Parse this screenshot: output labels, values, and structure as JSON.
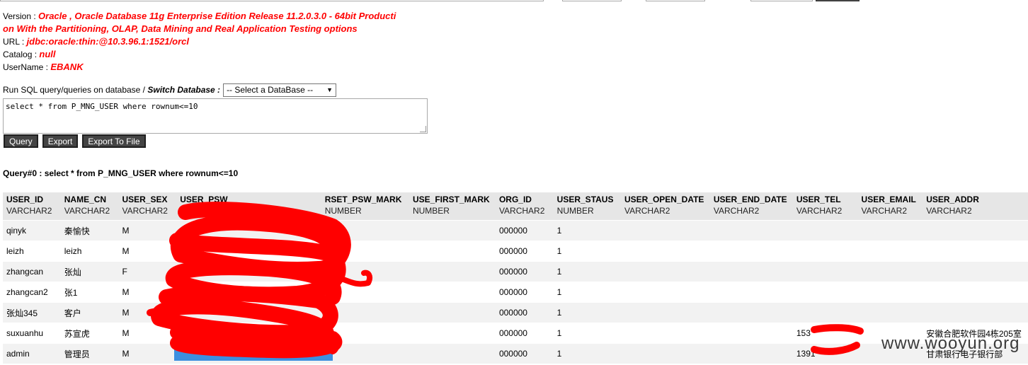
{
  "info": {
    "version_label": "Version : ",
    "version_value_1": "Oracle , Oracle Database 11g Enterprise Edition Release 11.2.0.3.0 - 64bit Producti",
    "version_value_2": "on With the Partitioning, OLAP, Data Mining and Real Application Testing options",
    "url_label": "URL : ",
    "url_value": "jdbc:oracle:thin:@10.3.96.1:1521/orcl",
    "catalog_label": "Catalog : ",
    "catalog_value": "null",
    "username_label": "UserName : ",
    "username_value": "EBANK"
  },
  "run": {
    "prefix": "Run SQL query/queries on database / ",
    "switch_label": "Switch Database :",
    "select_value": "-- Select a DataBase --",
    "select_arrow": "▼"
  },
  "sql": {
    "text": "select * from P_MNG_USER where rownum<=10"
  },
  "buttons": {
    "query": "Query",
    "export": "Export",
    "export_file": "Export To File"
  },
  "query_title": "Query#0 : select * from P_MNG_USER where rownum<=10",
  "table": {
    "columns": [
      {
        "name": "USER_ID",
        "type": "VARCHAR2"
      },
      {
        "name": "NAME_CN",
        "type": "VARCHAR2"
      },
      {
        "name": "USER_SEX",
        "type": "VARCHAR2"
      },
      {
        "name": "USER_PSW",
        "type": "VARCHAR2"
      },
      {
        "name": "RSET_PSW_MARK",
        "type": "NUMBER"
      },
      {
        "name": "USE_FIRST_MARK",
        "type": "NUMBER"
      },
      {
        "name": "ORG_ID",
        "type": "VARCHAR2"
      },
      {
        "name": "USER_STAUS",
        "type": "NUMBER"
      },
      {
        "name": "USER_OPEN_DATE",
        "type": "VARCHAR2"
      },
      {
        "name": "USER_END_DATE",
        "type": "VARCHAR2"
      },
      {
        "name": "USER_TEL",
        "type": "VARCHAR2"
      },
      {
        "name": "USER_EMAIL",
        "type": "VARCHAR2"
      },
      {
        "name": "USER_ADDR",
        "type": "VARCHAR2"
      }
    ],
    "rows": [
      [
        "qinyk",
        "秦愉快",
        "M",
        "",
        "",
        "",
        "000000",
        "1",
        "",
        "",
        "",
        "",
        ""
      ],
      [
        "leizh",
        "leizh",
        "M",
        "",
        "",
        "",
        "000000",
        "1",
        "",
        "",
        "",
        "",
        ""
      ],
      [
        "zhangcan",
        "张灿",
        "F",
        "",
        "",
        "",
        "000000",
        "1",
        "",
        "",
        "",
        "",
        ""
      ],
      [
        "zhangcan2",
        "张1",
        "M",
        "",
        "",
        "",
        "000000",
        "1",
        "",
        "",
        "",
        "",
        ""
      ],
      [
        "张灿345",
        "客户",
        "M",
        "",
        "",
        "",
        "000000",
        "1",
        "",
        "",
        "",
        "",
        ""
      ],
      [
        "suxuanhu",
        "苏宣虎",
        "M",
        "",
        "",
        "",
        "000000",
        "1",
        "",
        "",
        "153",
        "",
        "安徽合肥软件园4栋205室"
      ],
      [
        "admin",
        "管理员",
        "M",
        "",
        "",
        "",
        "000000",
        "1",
        "",
        "",
        "1391",
        "",
        "甘肃银行电子银行部"
      ]
    ]
  },
  "watermark": "www.wooyun.org",
  "colors": {
    "accent_red": "#ff0000",
    "header_bg": "#e6e6e6",
    "button_bg": "#444444"
  }
}
